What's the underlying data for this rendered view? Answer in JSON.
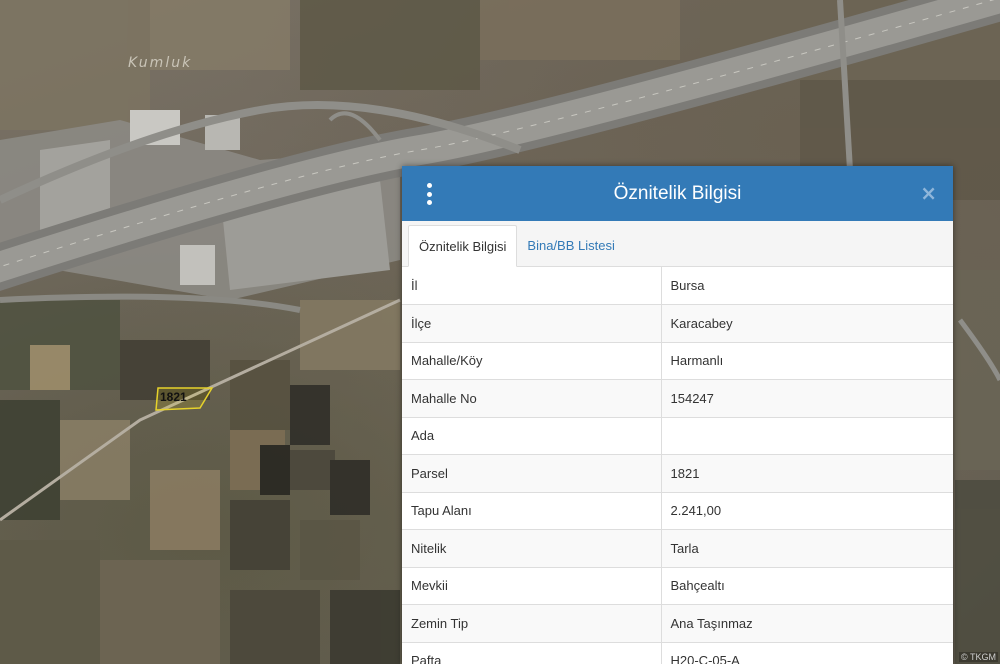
{
  "map": {
    "place_label": "Kumluk",
    "parcel_label": "1821",
    "attribution": "© TKGM"
  },
  "panel": {
    "title": "Öznitelik Bilgisi",
    "menu_icon": "vertical-dots-icon",
    "close_icon": "close-icon",
    "close_glyph": "×",
    "header_color": "#337ab7",
    "tabs": [
      {
        "label": "Öznitelik Bilgisi",
        "active": true
      },
      {
        "label": "Bina/BB Listesi",
        "active": false
      }
    ],
    "rows": [
      {
        "key": "İl",
        "value": "Bursa"
      },
      {
        "key": "İlçe",
        "value": "Karacabey"
      },
      {
        "key": "Mahalle/Köy",
        "value": "Harmanlı"
      },
      {
        "key": "Mahalle No",
        "value": "154247"
      },
      {
        "key": "Ada",
        "value": ""
      },
      {
        "key": "Parsel",
        "value": "1821"
      },
      {
        "key": "Tapu Alanı",
        "value": "2.241,00"
      },
      {
        "key": "Nitelik",
        "value": "Tarla"
      },
      {
        "key": "Mevkii",
        "value": "Bahçealtı"
      },
      {
        "key": "Zemin Tip",
        "value": "Ana Taşınmaz"
      },
      {
        "key": "Pafta",
        "value": "H20-C-05-A"
      }
    ]
  }
}
